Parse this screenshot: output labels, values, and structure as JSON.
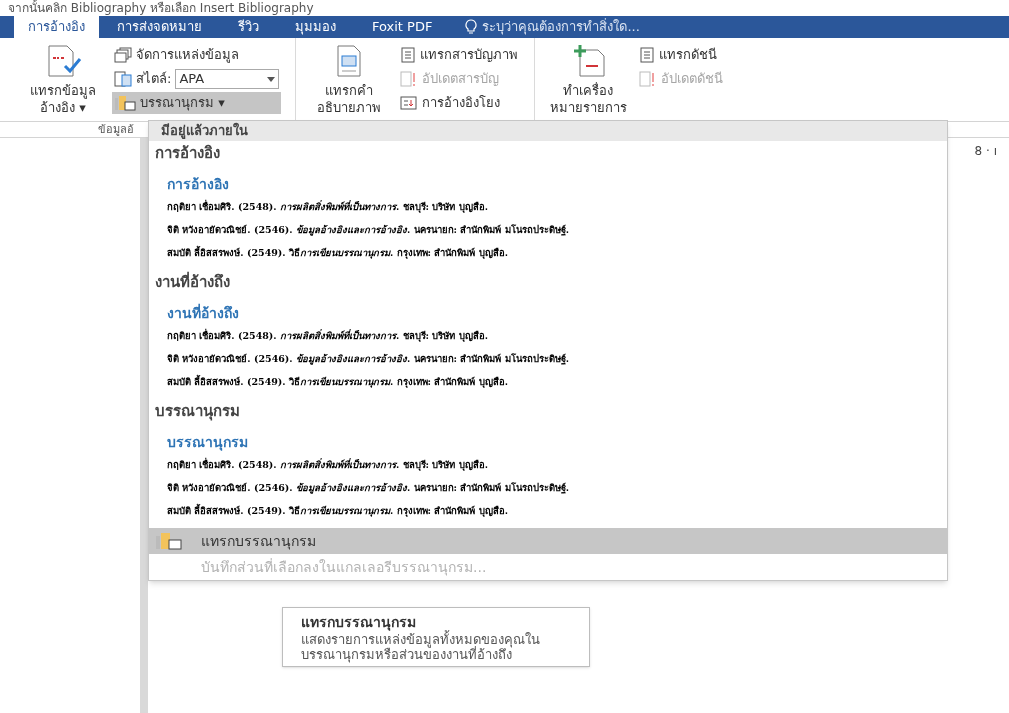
{
  "caption_line": "จากนั้นคลิก Bibliography หรือเลือก Insert Bibliography",
  "tabs": [
    {
      "label": "การอ้างอิง",
      "selected": true
    },
    {
      "label": "การส่งจดหมาย",
      "selected": false
    },
    {
      "label": "รีวิว",
      "selected": false
    },
    {
      "label": "มุมมอง",
      "selected": false
    },
    {
      "label": "Foxit PDF",
      "selected": false
    }
  ],
  "tell_me": "ระบุว่าคุณต้องการทำสิ่งใด...",
  "ribbon_groups": [
    {
      "label": "ข้อมูลอ้",
      "large": {
        "lines": [
          "แทรกข้อมูล",
          "อ้างอิง ▾"
        ]
      },
      "small": [
        {
          "kind": "button",
          "label": "จัดการแหล่งข้อมูล",
          "disabled": false,
          "pressed": false
        },
        {
          "kind": "combo",
          "label": "สไตล์:",
          "value": "APA",
          "disabled": false,
          "pressed": false
        },
        {
          "kind": "button",
          "label": "บรรณานุกรม ▾",
          "disabled": false,
          "pressed": true
        }
      ]
    },
    {
      "large": {
        "lines": [
          "แทรกคำ",
          "อธิบายภาพ"
        ]
      },
      "small": [
        {
          "kind": "button",
          "label": "แทรกสารบัญภาพ",
          "disabled": false,
          "pressed": false
        },
        {
          "kind": "button",
          "label": "อัปเดตสารบัญ",
          "disabled": true,
          "pressed": false
        },
        {
          "kind": "button",
          "label": "การอ้างอิงโยง",
          "disabled": false,
          "pressed": false
        }
      ]
    },
    {
      "large": {
        "lines": [
          "ทำเครื่อง",
          "หมายรายการ"
        ]
      },
      "small": [
        {
          "kind": "button",
          "label": "แทรกดัชนี",
          "disabled": false,
          "pressed": false
        },
        {
          "kind": "button",
          "label": "อัปเดตดัชนี",
          "disabled": true,
          "pressed": false
        }
      ]
    }
  ],
  "ruler_text": "8 · ı",
  "dropdown": {
    "header": "มีอยู่แล้วภายใน",
    "gallery": [
      {
        "title": "การอ้างอิง",
        "heading": "การอ้างอิง",
        "entries": [
          "กฤติยา เชื่อมศิริ. (2548). *การผลิตสิ่งพิมพ์ที่เป็นทางการ*. ชลบุรี: บริษัท บุญสือ.",
          "จิติ หวังอายัดวณิชย์. (2546). *ข้อมูลอ้างอิงและการอ้างอิง*. นครนายก: สำนักพิมพ์ มโนรถประดิษฐ์.",
          "สมบัติ ลี้อิสสรพงษ์. (2549). วิธี*การเขียนบรรณานุกรม*. กรุงเทพ: สำนักพิมพ์ บุญสือ."
        ]
      },
      {
        "title": "งานที่อ้างถึง",
        "heading": "งานที่อ้างถึง",
        "entries": [
          "กฤติยา เชื่อมศิริ. (2548). *การผลิตสิ่งพิมพ์ที่เป็นทางการ*. ชลบุรี: บริษัท บุญสือ.",
          "จิติ หวังอายัดวณิชย์. (2546). *ข้อมูลอ้างอิงและการอ้างอิง*. นครนายก: สำนักพิมพ์ มโนรถประดิษฐ์.",
          "สมบัติ ลี้อิสสรพงษ์. (2549). วิธี*การเขียนบรรณานุกรม*. กรุงเทพ: สำนักพิมพ์ บุญสือ."
        ]
      },
      {
        "title": "บรรณานุกรม",
        "heading": "บรรณานุกรม",
        "entries": [
          "กฤติยา เชื่อมศิริ. (2548). *การผลิตสิ่งพิมพ์ที่เป็นทางการ*. ชลบุรี: บริษัท บุญสือ.",
          "จิติ หวังอายัดวณิชย์. (2546). *ข้อมูลอ้างอิงและการอ้างอิง*. นครนายก: สำนักพิมพ์ มโนรถประดิษฐ์.",
          "สมบัติ ลี้อิสสรพงษ์. (2549). วิธี*การเขียนบรรณานุกรม*. กรุงเทพ: สำนักพิมพ์ บุญสือ."
        ]
      }
    ],
    "menu_items": [
      {
        "label": "แทรกบรรณานุกรม",
        "selected": true,
        "disabled": false
      },
      {
        "label": "บันทึกส่วนที่เลือกลงในแกลเลอรีบรรณานุกรม...",
        "selected": false,
        "disabled": true
      }
    ]
  },
  "tooltip": {
    "title": "แทรกบรรณานุกรม",
    "body": "แสดงรายการแหล่งข้อมูลทั้งหมดของคุณในบรรณานุกรมหรือส่วนของงานที่อ้างถึง"
  }
}
